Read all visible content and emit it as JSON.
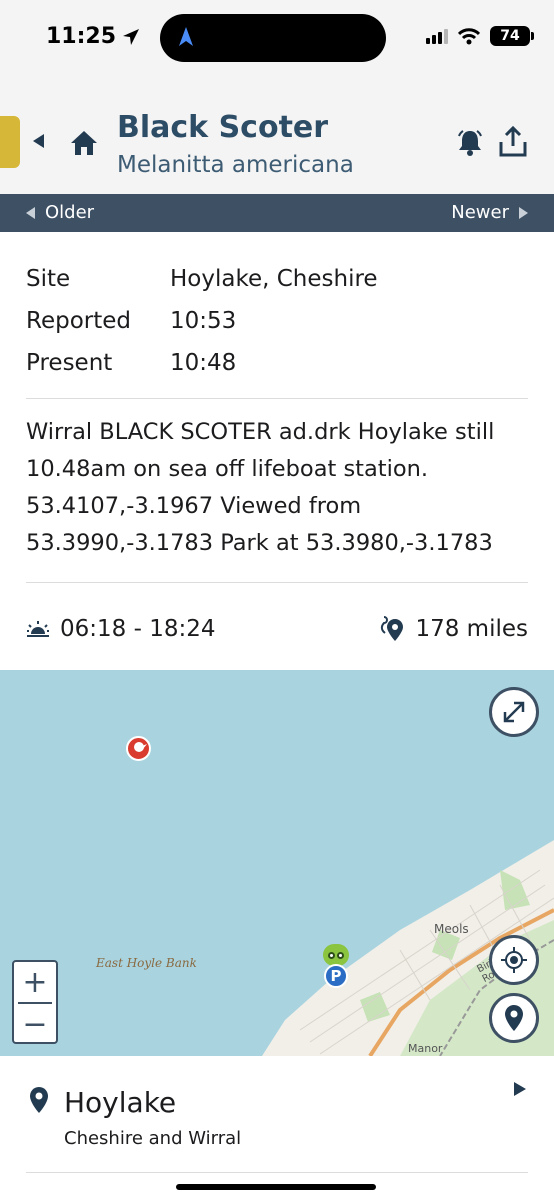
{
  "status_bar": {
    "time": "11:25",
    "battery": "74",
    "icons": [
      "location-arrow-icon",
      "signal-icon",
      "wifi-icon",
      "battery-icon"
    ]
  },
  "header": {
    "title": "Black Scoter",
    "subtitle": "Melanitta americana",
    "icons": [
      "back-icon",
      "home-icon",
      "bell-icon",
      "share-icon"
    ],
    "accent_color": "#d7b737",
    "title_color": "#2d4d66"
  },
  "navbar": {
    "older_label": "Older",
    "newer_label": "Newer",
    "background": "#3d5064"
  },
  "details": {
    "rows": [
      {
        "label": "Site",
        "value": "Hoylake, Cheshire"
      },
      {
        "label": "Reported",
        "value": "10:53"
      },
      {
        "label": "Present",
        "value": "10:48"
      }
    ],
    "description": "Wirral BLACK SCOTER ad.drk Hoylake still 10.48am on sea off lifeboat station. 53.4107,-3.1967 Viewed from 53.3990,-3.1783 Park at 53.3980,-3.1783",
    "sun_times": "06:18 - 18:24",
    "distance": "178 miles"
  },
  "map": {
    "labels": {
      "sandbank": "East Hoyle Bank",
      "town": "Meols",
      "road": "Birkenhead Road",
      "manor": "Manor"
    },
    "park_marker": "P",
    "sea_color": "#a9d3df",
    "marker_color": "#d93b2e",
    "zoom_in": "+",
    "zoom_out": "−"
  },
  "location": {
    "name": "Hoylake",
    "region": "Cheshire and Wirral"
  }
}
